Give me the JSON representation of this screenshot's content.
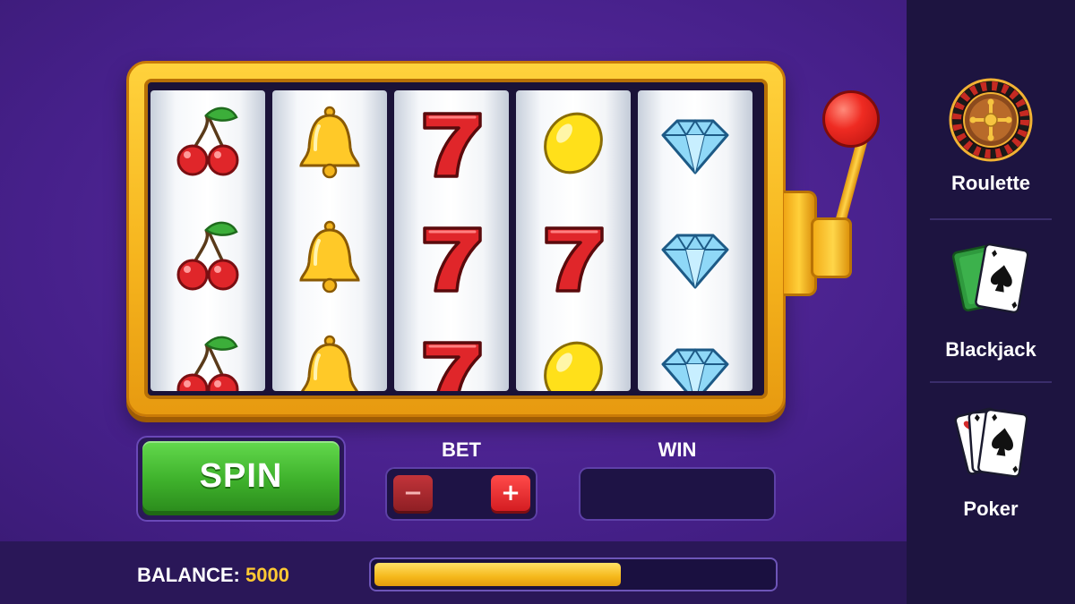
{
  "controls": {
    "spin_label": "SPIN",
    "bet_label": "BET",
    "bet_minus": "−",
    "bet_plus": "+",
    "win_label": "WIN",
    "win_value": ""
  },
  "balance": {
    "label": "BALANCE:",
    "value": "5000",
    "progress_fraction": 0.62
  },
  "reels": [
    [
      "cherry",
      "cherry",
      "cherry"
    ],
    [
      "bell",
      "bell",
      "bell"
    ],
    [
      "seven",
      "seven",
      "seven"
    ],
    [
      "lemon",
      "seven",
      "lemon"
    ],
    [
      "diamond",
      "diamond",
      "diamond"
    ]
  ],
  "sidebar": {
    "items": [
      {
        "label": "Roulette",
        "icon": "roulette-wheel-icon"
      },
      {
        "label": "Blackjack",
        "icon": "blackjack-cards-icon"
      },
      {
        "label": "Poker",
        "icon": "poker-cards-icon"
      }
    ]
  },
  "colors": {
    "background": "#46208a",
    "cabinet_gold": "#f6b51e",
    "spin_green": "#3fb22c",
    "balance_value": "#ffc933",
    "lever_knob": "#ef2b22"
  }
}
